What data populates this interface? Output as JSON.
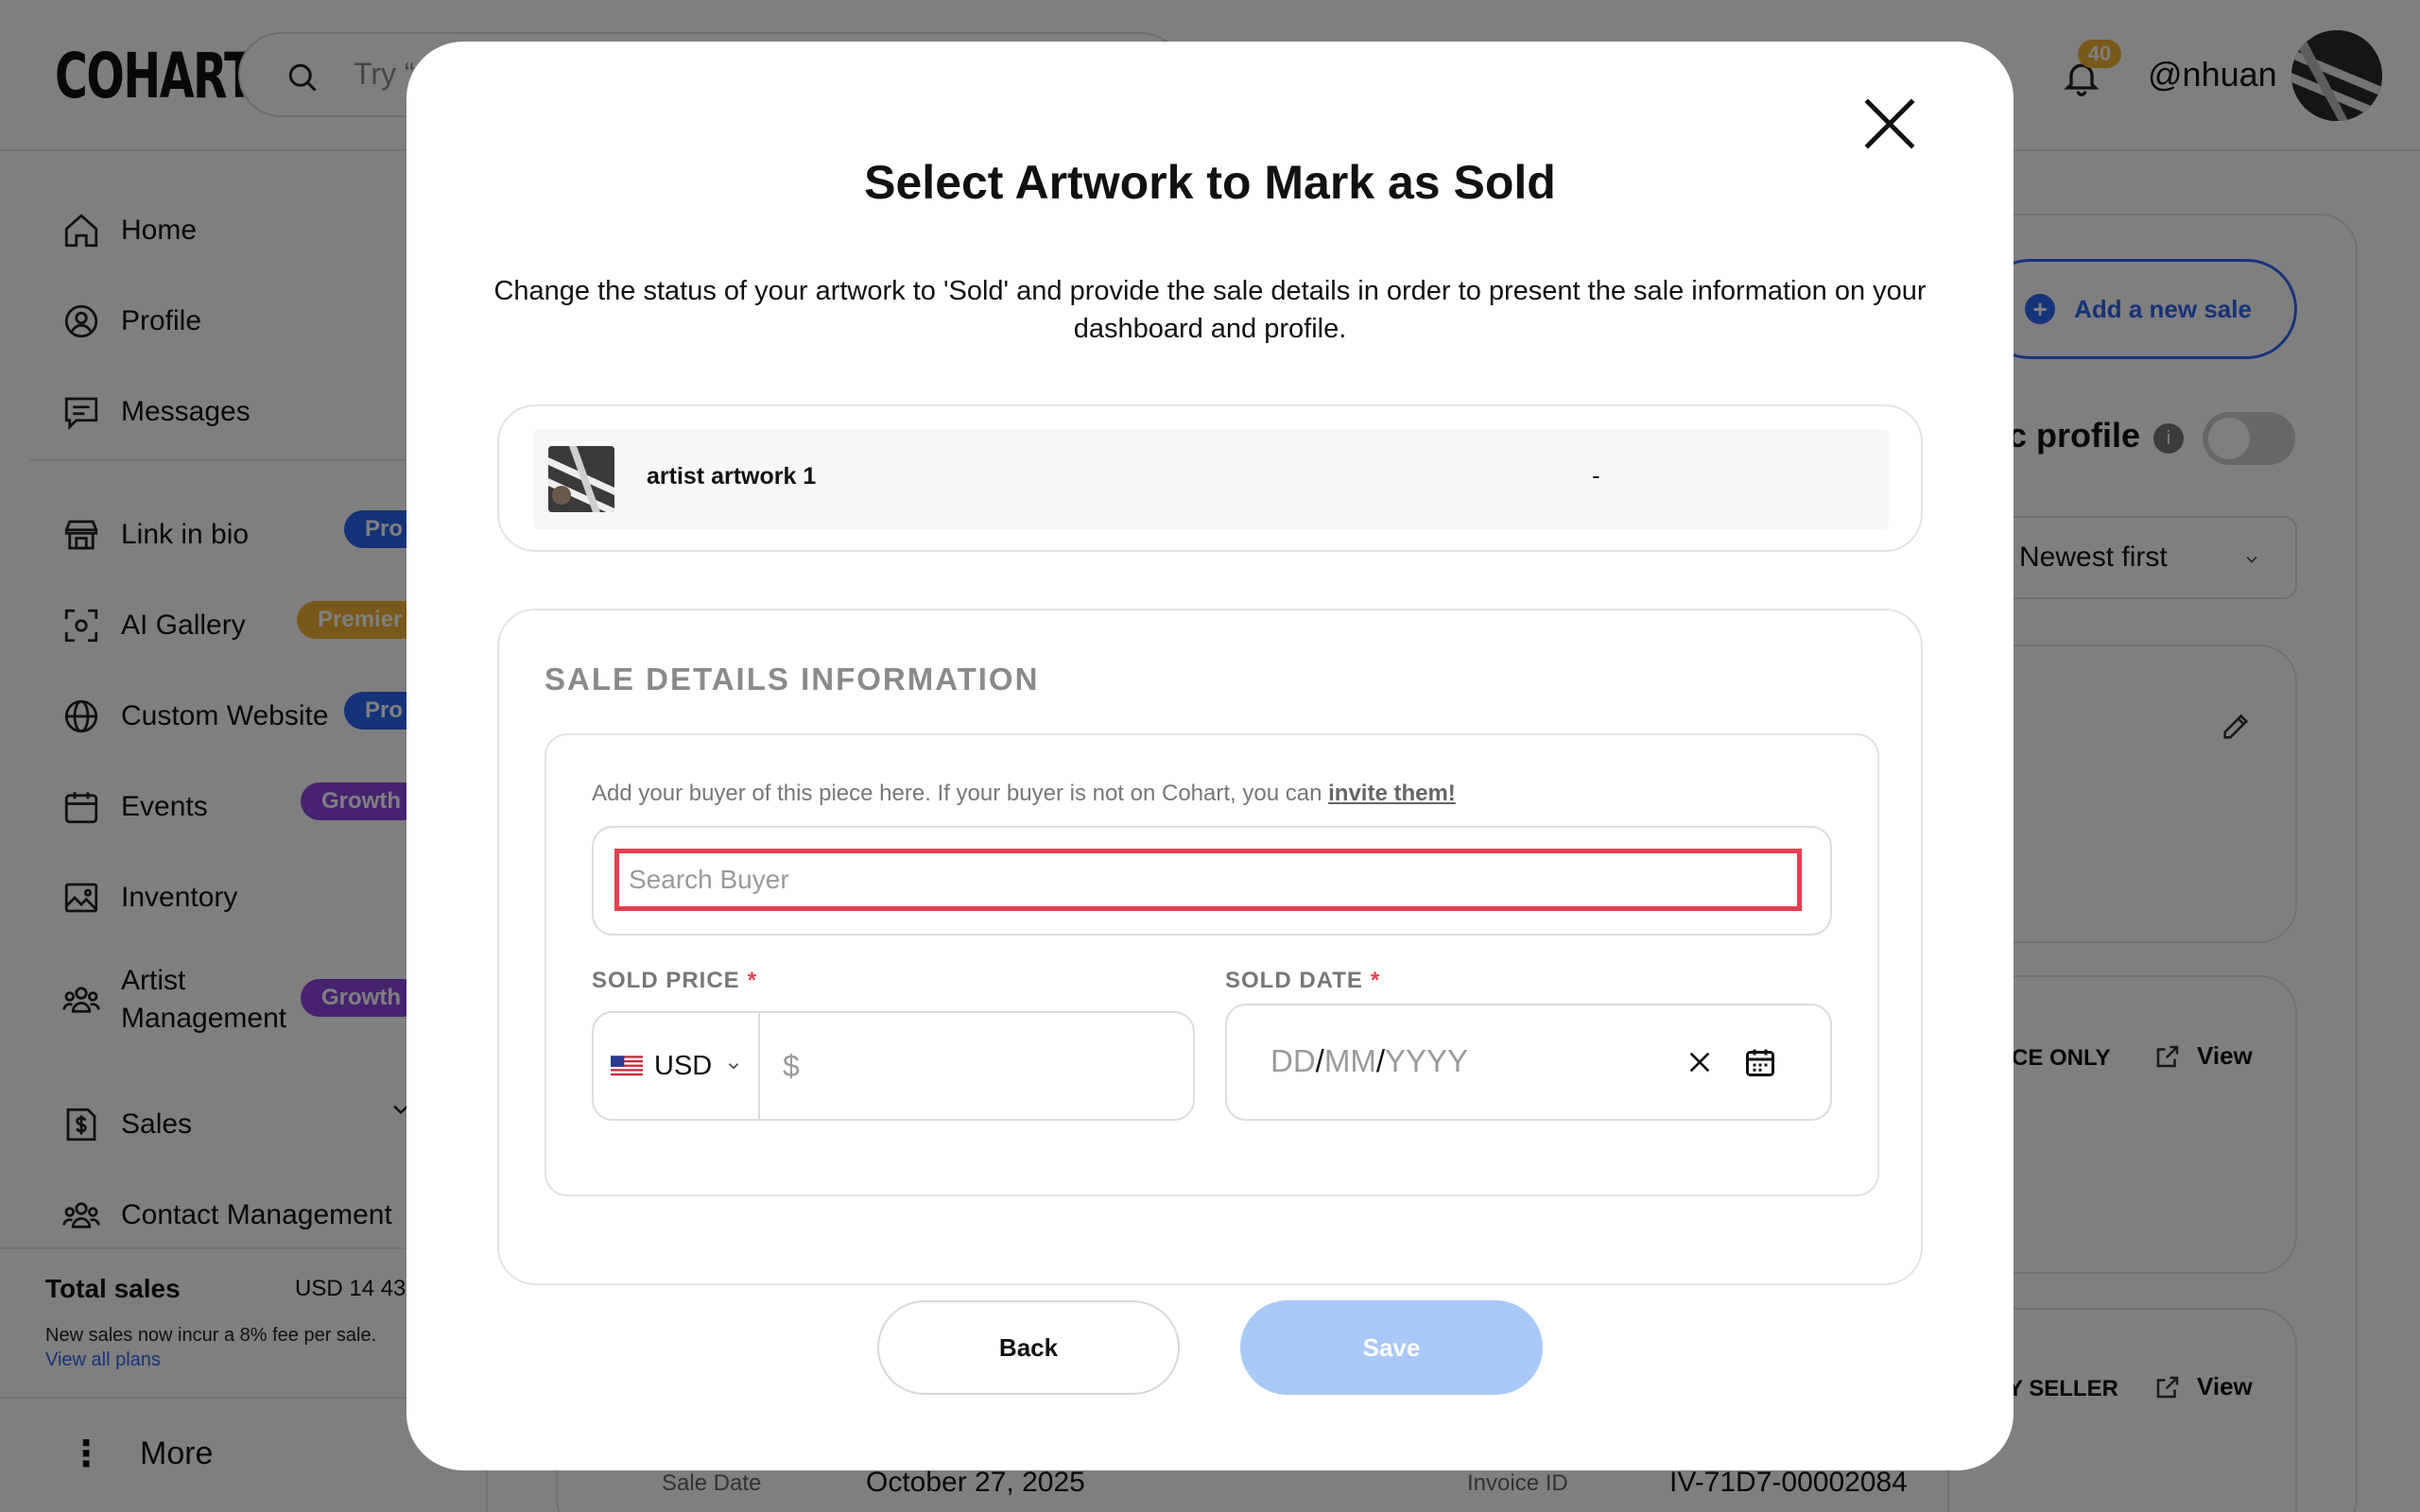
{
  "app": {
    "logo": "COHART"
  },
  "header": {
    "search_placeholder": "Try “",
    "notifications_count": "40",
    "username": "@nhuan"
  },
  "sidebar": {
    "items": [
      {
        "label": "Home",
        "icon": "home-icon"
      },
      {
        "label": "Profile",
        "icon": "user-icon"
      },
      {
        "label": "Messages",
        "icon": "message-icon"
      },
      {
        "label": "Link in bio",
        "icon": "store-icon",
        "badge": "Pro"
      },
      {
        "label": "AI Gallery",
        "icon": "scan-face-icon",
        "badge": "Premier"
      },
      {
        "label": "Custom Website",
        "icon": "globe-icon",
        "badge": "Pro"
      },
      {
        "label": "Events",
        "icon": "calendar-icon",
        "badge": "Growth"
      },
      {
        "label": "Inventory",
        "icon": "image-icon"
      },
      {
        "label": "Artist Management",
        "label_line1": "Artist",
        "label_line2": "Management",
        "icon": "users-icon",
        "badge": "Growth"
      },
      {
        "label": "Sales",
        "icon": "dollar-icon"
      },
      {
        "label": "Contact Management",
        "icon": "users-icon"
      }
    ],
    "total_sales_label": "Total sales",
    "total_sales_value": "USD 14 43",
    "fee_note": "New sales now incur a 8% fee per sale.",
    "plans_link": "View all plans",
    "more_label": "More"
  },
  "main": {
    "add_sale_label": "Add a new sale",
    "public_profile_label": "ic profile",
    "sort_value": "Newest first",
    "card_tags": [
      "CE ONLY",
      "Y SELLER"
    ],
    "view_label": "View",
    "sale_date_label": "Sale Date",
    "sale_date_value": "October 27, 2025",
    "invoice_label": "Invoice ID",
    "invoice_value": "IV-71D7-00002084"
  },
  "modal": {
    "title": "Select Artwork to Mark as Sold",
    "description": "Change the status of your artwork to 'Sold' and provide the sale details in order to present the sale information on your dashboard and profile.",
    "artwork": {
      "name": "artist artwork 1",
      "price": "-"
    },
    "details_heading": "SALE DETAILS INFORMATION",
    "buyer_hint": "Add your buyer of this piece here. If your buyer is not on Cohart, you can",
    "invite_link": "invite them!",
    "search_buyer_placeholder": "Search Buyer",
    "sold_price_label": "SOLD PRICE",
    "sold_date_label": "SOLD DATE",
    "required_mark": "*",
    "currency": "USD",
    "price_placeholder": "$",
    "date_placeholder": {
      "dd": "DD",
      "mm": "MM",
      "yyyy": "YYYY",
      "sep": "/"
    },
    "back_label": "Back",
    "save_label": "Save"
  },
  "colors": {
    "accent": "#2b66f0",
    "danger": "#e5404f",
    "save_disabled": "#a9c8f7",
    "pro": "#2b66f0",
    "premier": "#f2b233",
    "growth": "#8e45e0"
  }
}
